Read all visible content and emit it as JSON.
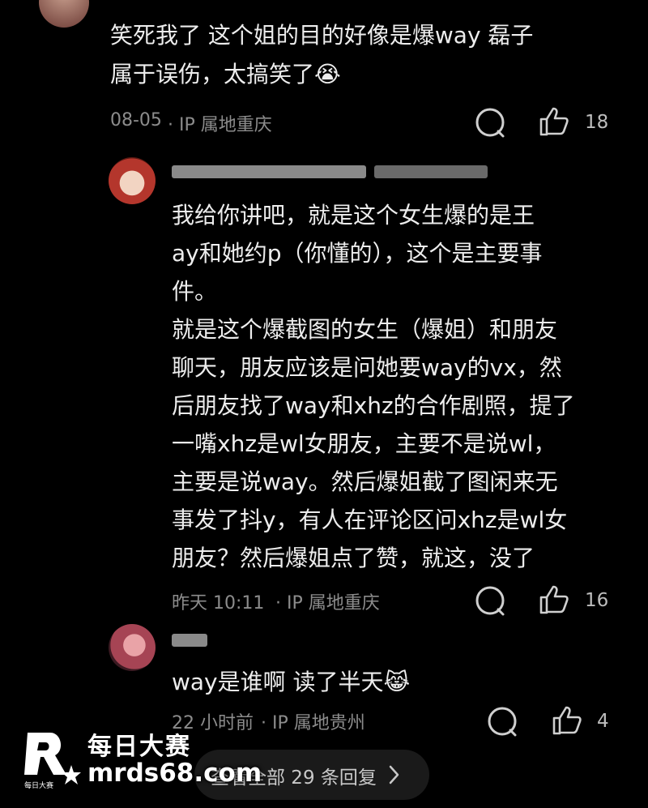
{
  "top_comment": {
    "text_line1": "笑死我了 这个姐的目的好像是爆way 磊子",
    "text_line2": "属于误伤，太搞笑了😭",
    "time": "08-05",
    "ip": "· IP 属地重庆",
    "likes": "18"
  },
  "reply1": {
    "text_lines": [
      "我给你讲吧，就是这个女生爆的是王",
      "ay和她约p（你懂的），这个是主要事",
      "件。",
      "就是这个爆截图的女生（爆姐）和朋友",
      "聊天，朋友应该是问她要way的vx，然",
      "后朋友找了way和xhz的合作剧照，提了",
      "一嘴xhz是wl女朋友，主要不是说wl，",
      "主要是说way。然后爆姐截了图闲来无",
      "事发了抖y，有人在评论区问xhz是wl女",
      "朋友？然后爆姐点了赞，就这，没了"
    ],
    "time": "昨天 10:11",
    "ip": "· IP 属地重庆",
    "likes": "16"
  },
  "reply2": {
    "text": "way是谁啊 读了半天😹",
    "time": "22 小时前",
    "ip": "· IP 属地贵州",
    "likes": "4"
  },
  "view_all_label": "查看全部 29 条回复",
  "watermark": {
    "title": "每日大赛",
    "url": "mrds68.com",
    "logo_sub": "每日大赛"
  },
  "colors": {
    "background": "#000000",
    "text": "#ededed",
    "meta": "#8c8c8c"
  }
}
